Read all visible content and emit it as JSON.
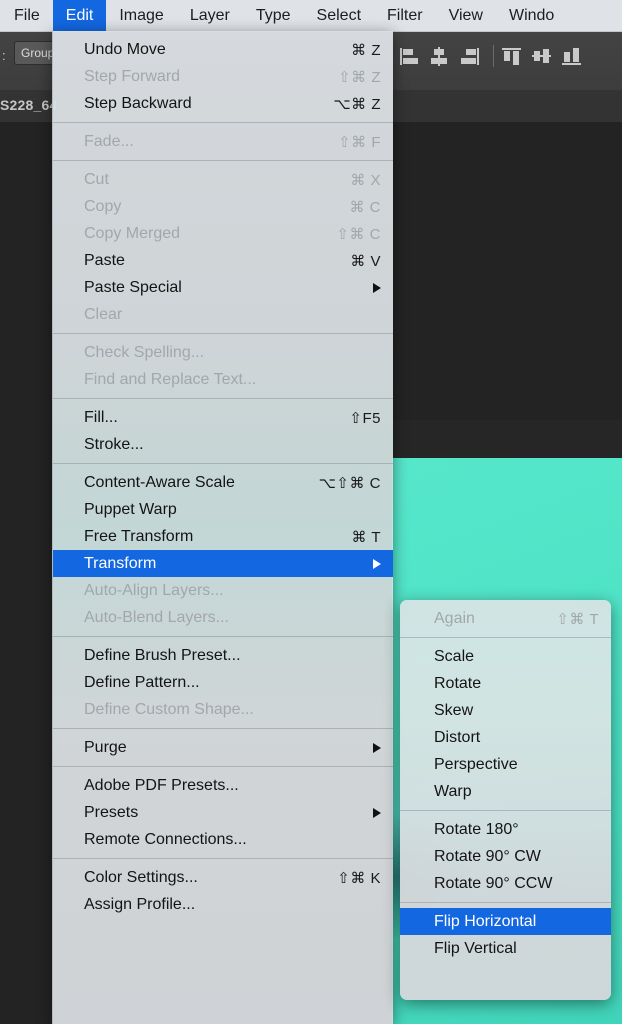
{
  "app": {
    "options_bar": {
      "prefix_label": ":",
      "group_button": "Group",
      "align_icons": [
        "align-left-edges-icon",
        "align-horizontal-centers-icon",
        "align-right-edges-icon",
        "align-top-edges-icon",
        "align-vertical-centers-icon",
        "align-bottom-edges-icon"
      ]
    },
    "document_tab": "S228_64"
  },
  "menubar": {
    "items": [
      {
        "label": "File",
        "active": false
      },
      {
        "label": "Edit",
        "active": true
      },
      {
        "label": "Image",
        "active": false
      },
      {
        "label": "Layer",
        "active": false
      },
      {
        "label": "Type",
        "active": false
      },
      {
        "label": "Select",
        "active": false
      },
      {
        "label": "Filter",
        "active": false
      },
      {
        "label": "View",
        "active": false
      },
      {
        "label": "Windo",
        "active": false
      }
    ]
  },
  "edit_menu": {
    "title": "Edit",
    "groups": [
      {
        "items": [
          {
            "label": "Undo Move",
            "shortcut": "⌘ Z",
            "state": "enabled"
          },
          {
            "label": "Step Forward",
            "shortcut": "⇧⌘ Z",
            "state": "disabled"
          },
          {
            "label": "Step Backward",
            "shortcut": "⌥⌘ Z",
            "state": "enabled"
          }
        ]
      },
      {
        "items": [
          {
            "label": "Fade...",
            "shortcut": "⇧⌘ F",
            "state": "disabled"
          }
        ]
      },
      {
        "items": [
          {
            "label": "Cut",
            "shortcut": "⌘ X",
            "state": "disabled"
          },
          {
            "label": "Copy",
            "shortcut": "⌘ C",
            "state": "disabled"
          },
          {
            "label": "Copy Merged",
            "shortcut": "⇧⌘ C",
            "state": "disabled"
          },
          {
            "label": "Paste",
            "shortcut": "⌘ V",
            "state": "enabled"
          },
          {
            "label": "Paste Special",
            "shortcut": "",
            "state": "enabled",
            "submenu": true
          },
          {
            "label": "Clear",
            "shortcut": "",
            "state": "disabled"
          }
        ]
      },
      {
        "items": [
          {
            "label": "Check Spelling...",
            "shortcut": "",
            "state": "disabled"
          },
          {
            "label": "Find and Replace Text...",
            "shortcut": "",
            "state": "disabled"
          }
        ]
      },
      {
        "items": [
          {
            "label": "Fill...",
            "shortcut": "⇧F5",
            "state": "enabled"
          },
          {
            "label": "Stroke...",
            "shortcut": "",
            "state": "enabled"
          }
        ]
      },
      {
        "items": [
          {
            "label": "Content-Aware Scale",
            "shortcut": "⌥⇧⌘ C",
            "state": "enabled"
          },
          {
            "label": "Puppet Warp",
            "shortcut": "",
            "state": "enabled"
          },
          {
            "label": "Free Transform",
            "shortcut": "⌘ T",
            "state": "enabled"
          },
          {
            "label": "Transform",
            "shortcut": "",
            "state": "highlighted",
            "submenu": true
          },
          {
            "label": "Auto-Align Layers...",
            "shortcut": "",
            "state": "disabled"
          },
          {
            "label": "Auto-Blend Layers...",
            "shortcut": "",
            "state": "disabled"
          }
        ]
      },
      {
        "items": [
          {
            "label": "Define Brush Preset...",
            "shortcut": "",
            "state": "enabled"
          },
          {
            "label": "Define Pattern...",
            "shortcut": "",
            "state": "enabled"
          },
          {
            "label": "Define Custom Shape...",
            "shortcut": "",
            "state": "disabled"
          }
        ]
      },
      {
        "items": [
          {
            "label": "Purge",
            "shortcut": "",
            "state": "enabled",
            "submenu": true
          }
        ]
      },
      {
        "items": [
          {
            "label": "Adobe PDF Presets...",
            "shortcut": "",
            "state": "enabled"
          },
          {
            "label": "Presets",
            "shortcut": "",
            "state": "enabled",
            "submenu": true
          },
          {
            "label": "Remote Connections...",
            "shortcut": "",
            "state": "enabled"
          }
        ]
      },
      {
        "items": [
          {
            "label": "Color Settings...",
            "shortcut": "⇧⌘ K",
            "state": "enabled"
          },
          {
            "label": "Assign Profile...",
            "shortcut": "",
            "state": "enabled"
          }
        ]
      }
    ]
  },
  "transform_submenu": {
    "title": "Transform",
    "groups": [
      {
        "items": [
          {
            "label": "Again",
            "shortcut": "⇧⌘ T",
            "state": "disabled"
          }
        ]
      },
      {
        "items": [
          {
            "label": "Scale",
            "shortcut": "",
            "state": "enabled"
          },
          {
            "label": "Rotate",
            "shortcut": "",
            "state": "enabled"
          },
          {
            "label": "Skew",
            "shortcut": "",
            "state": "enabled"
          },
          {
            "label": "Distort",
            "shortcut": "",
            "state": "enabled"
          },
          {
            "label": "Perspective",
            "shortcut": "",
            "state": "enabled"
          },
          {
            "label": "Warp",
            "shortcut": "",
            "state": "enabled"
          }
        ]
      },
      {
        "items": [
          {
            "label": "Rotate 180°",
            "shortcut": "",
            "state": "enabled"
          },
          {
            "label": "Rotate 90° CW",
            "shortcut": "",
            "state": "enabled"
          },
          {
            "label": "Rotate 90° CCW",
            "shortcut": "",
            "state": "enabled"
          }
        ]
      },
      {
        "items": [
          {
            "label": "Flip Horizontal",
            "shortcut": "",
            "state": "highlighted"
          },
          {
            "label": "Flip Vertical",
            "shortcut": "",
            "state": "enabled"
          }
        ]
      }
    ]
  },
  "colors": {
    "menubar_bg": "#dfe3e7",
    "highlight_blue": "#1367e0",
    "menu_bg": "#d6dade",
    "disabled_text": "#a2a7ab",
    "text": "#141414",
    "artwork_teal": "#4fe3c6",
    "app_chrome": "#3d3d3d"
  }
}
